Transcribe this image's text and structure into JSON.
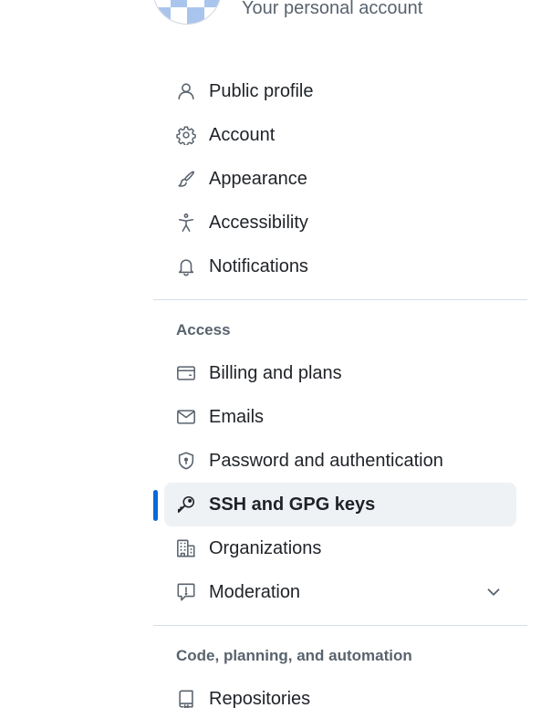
{
  "header": {
    "subtitle": "Your personal account"
  },
  "nav": {
    "primary_items": [
      {
        "label": "Public profile",
        "icon": "person-icon"
      },
      {
        "label": "Account",
        "icon": "gear-icon"
      },
      {
        "label": "Appearance",
        "icon": "paintbrush-icon"
      },
      {
        "label": "Accessibility",
        "icon": "accessibility-icon"
      },
      {
        "label": "Notifications",
        "icon": "bell-icon"
      }
    ],
    "access": {
      "header": "Access",
      "items": [
        {
          "label": "Billing and plans",
          "icon": "credit-card-icon"
        },
        {
          "label": "Emails",
          "icon": "mail-icon"
        },
        {
          "label": "Password and authentication",
          "icon": "shield-lock-icon"
        },
        {
          "label": "SSH and GPG keys",
          "icon": "key-icon",
          "selected": true
        },
        {
          "label": "Organizations",
          "icon": "organization-icon"
        },
        {
          "label": "Moderation",
          "icon": "report-icon",
          "expandable": true
        }
      ]
    },
    "code": {
      "header": "Code, planning, and automation",
      "items": [
        {
          "label": "Repositories",
          "icon": "repo-icon"
        }
      ]
    }
  },
  "colors": {
    "accent": "#0969da",
    "active_background": "#eff2f5",
    "muted_text": "#59636e",
    "text": "#1f2328",
    "divider": "#d8dee4"
  }
}
